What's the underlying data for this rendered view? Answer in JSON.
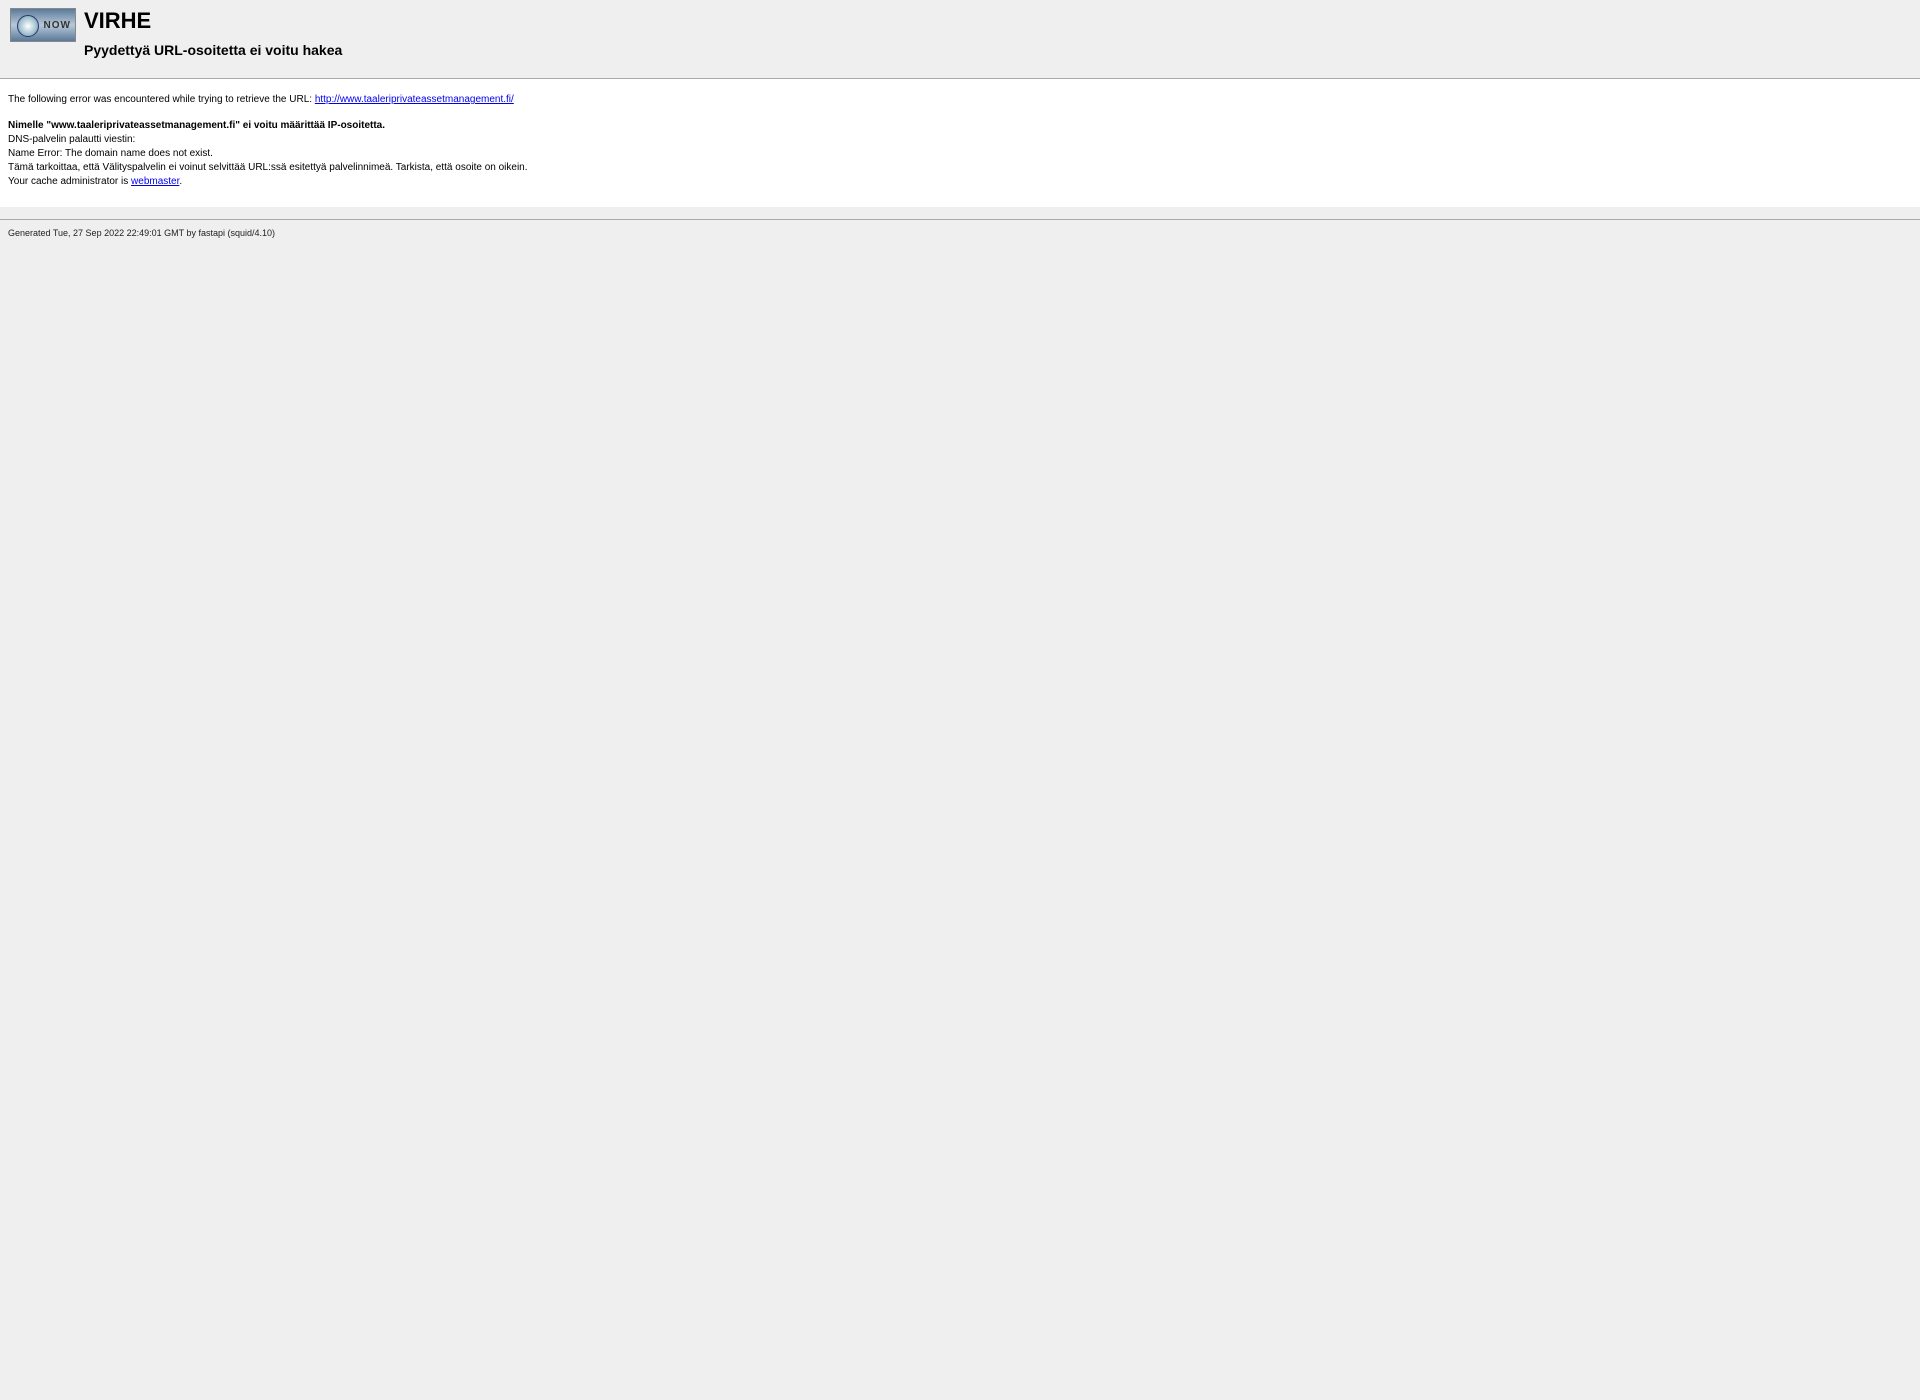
{
  "header": {
    "logo_text": "NOW",
    "title": "VIRHE",
    "subtitle": "Pyydettyä URL-osoitetta ei voitu hakea"
  },
  "body": {
    "error_prefix": "The following error was encountered while trying to retrieve the URL: ",
    "url": "http://www.taaleriprivateassetmanagement.fi/",
    "dns_error": "Nimelle \"www.taaleriprivateassetmanagement.fi\" ei voitu määrittää IP-osoitetta.",
    "dns_return": "DNS-palvelin palautti viestin:",
    "dns_message": "Name Error: The domain name does not exist.",
    "meaning": "Tämä tarkoittaa, että Välityspalvelin ei voinut selvittää URL:ssä esitettyä palvelinnimeä. Tarkista, että osoite on oikein.",
    "admin_prefix": "Your cache administrator is ",
    "admin_link": "webmaster",
    "admin_suffix": "."
  },
  "footer": {
    "generated": "Generated Tue, 27 Sep 2022 22:49:01 GMT by fastapi (squid/4.10)"
  }
}
